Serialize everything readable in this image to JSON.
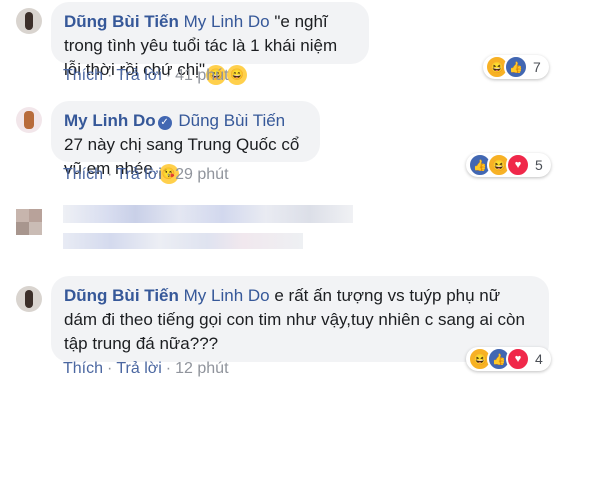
{
  "comments": [
    {
      "author": "Dũng Bùi Tiến",
      "tag": "My Linh Do",
      "text": "\"e nghĩ trong tình yêu tuổi tác là 1 khái niệm lỗi thời rồi chứ chị\"",
      "emoji": [
        "grinning-face",
        "grinning-face"
      ],
      "actions": {
        "like": "Thích",
        "reply": "Trả lời",
        "time": "41 phút"
      },
      "reactions": {
        "icons": [
          "haha",
          "like"
        ],
        "count": "7"
      }
    },
    {
      "author": "My Linh Do",
      "verified": true,
      "tag": "Dũng Bùi Tiến",
      "text": "27 này chị sang Trung Quốc cổ vũ em nhée",
      "emoji": [
        "face-blowing-kiss"
      ],
      "actions": {
        "like": "Thích",
        "reply": "Trả lời",
        "time": "29 phút"
      },
      "reactions": {
        "icons": [
          "like",
          "haha",
          "love"
        ],
        "count": "5"
      }
    },
    {
      "author": "Dũng Bùi Tiến",
      "tag": "My Linh Do",
      "text": "e rất ấn tượng vs tuýp phụ nữ dám đi theo tiếng gọi con tim như vậy,tuy nhiên c sang ai còn tập trung đá nữa???",
      "actions": {
        "like": "Thích",
        "reply": "Trả lời",
        "time": "12 phút"
      },
      "reactions": {
        "icons": [
          "haha",
          "like",
          "love"
        ],
        "count": "4"
      }
    }
  ],
  "icons": {
    "haha": "😆",
    "like": "👍",
    "love": "♥",
    "verified": "✓",
    "grinning-face": "😄",
    "face-blowing-kiss": "😘"
  },
  "colors": {
    "name_link": "#365899",
    "action_link": "#4b67a1",
    "meta_gray": "#90949c",
    "bubble_bg": "#f2f3f5",
    "like_blue": "#4267b2",
    "haha_yellow": "#f7b125",
    "love_red": "#f0284a"
  }
}
